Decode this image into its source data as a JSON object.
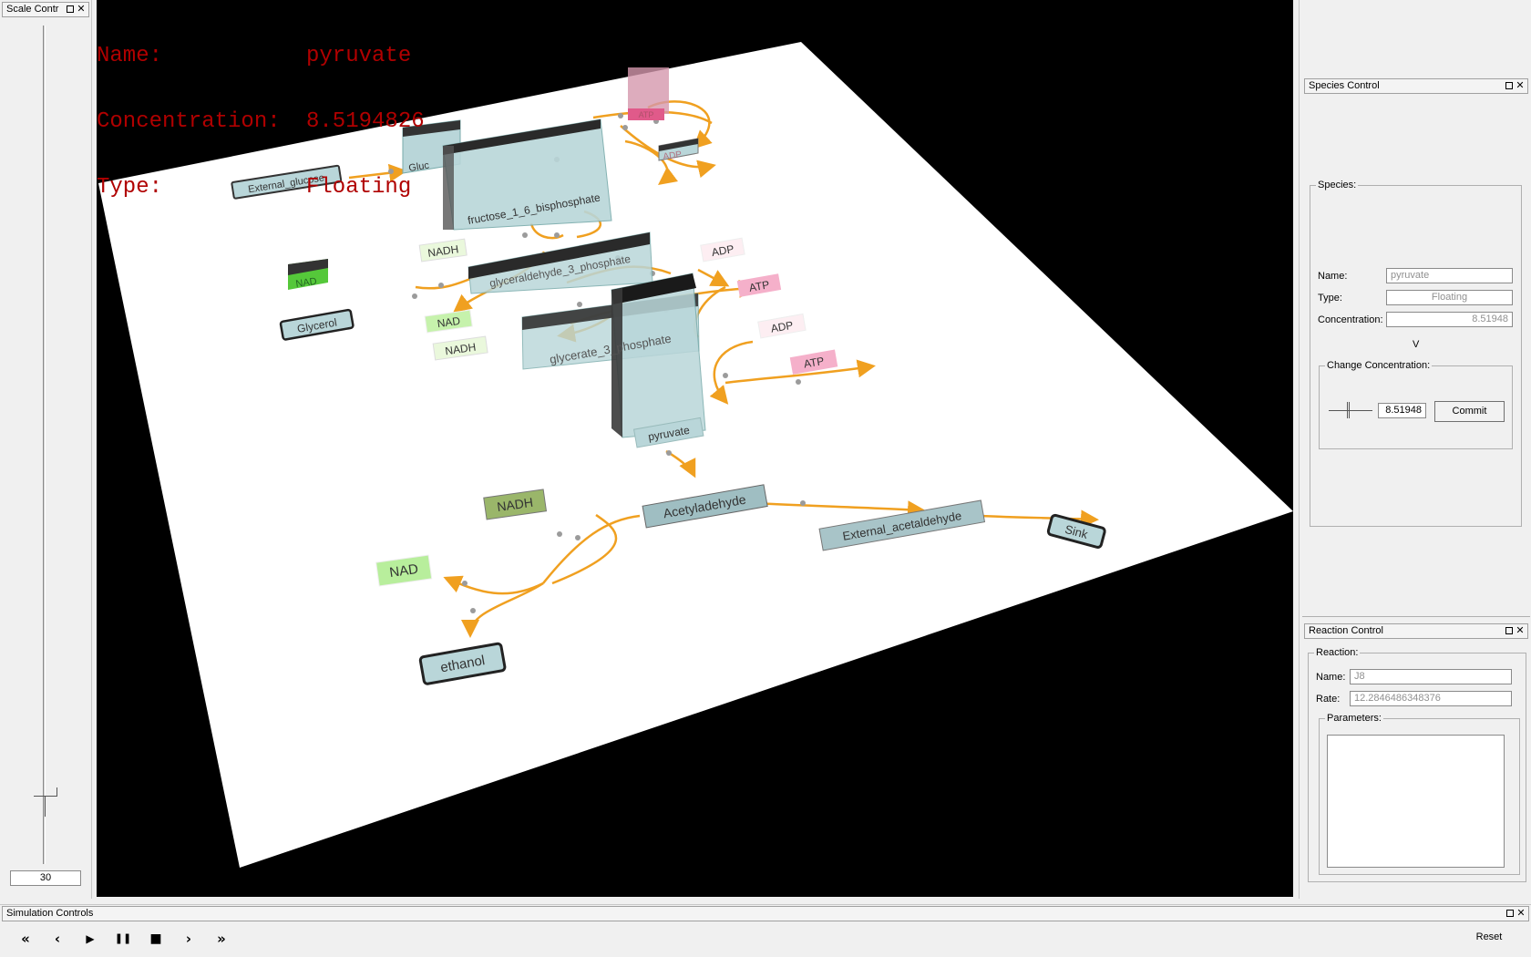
{
  "scale_control": {
    "title": "Scale Contr",
    "value": "30",
    "slider_level": 0.08
  },
  "viewport": {
    "hud": {
      "name_key": "Name:",
      "name_value": "pyruvate",
      "conc_key": "Concentration:",
      "conc_value": "8.5194826",
      "type_key": "Type:",
      "type_value": "Floating"
    },
    "nodes": {
      "external_glucose": "External_glucose",
      "glucose": "Gluc",
      "fructose": "fructose_1_6_bisphosphate",
      "atp_top": "ATP",
      "adp_top": "ADP",
      "nadh_1": "NADH",
      "g3p": "glyceraldehyde_3_phosphate",
      "adp_1": "ADP",
      "atp_1": "ATP",
      "nad_1": "NAD",
      "glycerol": "Glycerol",
      "nad_2": "NAD",
      "nadh_2": "NADH",
      "glycerate": "glycerate_3_phosphate",
      "adp_2": "ADP",
      "atp_2": "ATP",
      "pyruvate": "pyruvate",
      "nadh_3": "NADH",
      "acetyladehyde": "Acetyladehyde",
      "external_acetaldehyde": "External_acetaldehyde",
      "sink": "Sink",
      "nad_3": "NAD",
      "ethanol": "ethanol"
    }
  },
  "species_control": {
    "title": "Species Control",
    "group_label": "Species:",
    "name_label": "Name:",
    "name_value": "pyruvate",
    "type_label": "Type:",
    "type_value": "Floating",
    "conc_label": "Concentration:",
    "conc_value": "8.51948",
    "v_label": "V",
    "change_label": "Change Concentration:",
    "change_value": "8.51948",
    "commit_label": "Commit"
  },
  "reaction_control": {
    "title": "Reaction Control",
    "group_label": "Reaction:",
    "name_label": "Name:",
    "name_value": "J8",
    "rate_label": "Rate:",
    "rate_value": "12.2846486348376",
    "params_label": "Parameters:"
  },
  "simulation_controls": {
    "title": "Simulation Controls",
    "rewind": "«",
    "step_back": "‹",
    "play": "▶",
    "pause": "❚❚",
    "stop": "■",
    "step_forward": "›",
    "fast_forward": "»",
    "reset_label": "Reset"
  },
  "colors": {
    "species_node": "#b9d6d9",
    "reaction_arrow": "#f0a020",
    "hud_text": "#b00000",
    "atp_pink": "#f5a3c0",
    "nad_green": "#b8ee9c"
  }
}
